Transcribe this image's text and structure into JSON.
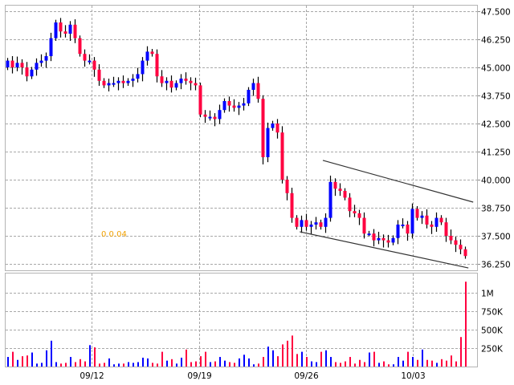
{
  "chart_data": {
    "type": "candlestick",
    "price_axis": {
      "ticks": [
        "47.500",
        "46.250",
        "45.000",
        "43.750",
        "42.500",
        "41.250",
        "40.000",
        "38.750",
        "37.500",
        "36.250"
      ],
      "ylim": [
        36.25,
        47.5
      ]
    },
    "volume_axis": {
      "ticks": [
        "1M",
        "750K",
        "500K",
        "250K"
      ],
      "ylim_k": [
        0,
        1000
      ]
    },
    "date_labels": [
      {
        "label": "09/12",
        "bar": 17.5
      },
      {
        "label": "09/19",
        "bar": 39.8
      },
      {
        "label": "09/26",
        "bar": 62
      },
      {
        "label": "10/03",
        "bar": 84.2
      }
    ],
    "indicator_text": "0 0.04",
    "up_color": "#0000ff",
    "down_color": "#ff0040",
    "first_open": 45.0,
    "close": [
      45.3,
      45.0,
      45.2,
      45.0,
      44.6,
      44.9,
      45.2,
      45.3,
      45.5,
      46.3,
      47.0,
      46.6,
      46.5,
      46.9,
      46.3,
      45.6,
      45.3,
      45.3,
      44.9,
      44.4,
      44.2,
      44.3,
      44.3,
      44.4,
      44.3,
      44.4,
      44.5,
      44.7,
      45.3,
      45.7,
      45.6,
      44.6,
      44.3,
      44.4,
      44.1,
      44.3,
      44.5,
      44.4,
      44.3,
      44.2,
      42.9,
      42.8,
      42.8,
      42.7,
      43.1,
      43.5,
      43.3,
      43.2,
      43.3,
      43.4,
      44.0,
      44.3,
      43.6,
      41.0,
      42.3,
      42.5,
      42.1,
      40.0,
      39.4,
      38.3,
      37.9,
      38.2,
      37.9,
      38.0,
      38.1,
      37.9,
      38.3,
      39.9,
      39.6,
      39.5,
      39.2,
      38.6,
      38.5,
      38.3,
      37.6,
      37.6,
      37.3,
      37.4,
      37.3,
      37.2,
      37.4,
      38.0,
      38.0,
      37.6,
      38.7,
      38.3,
      38.4,
      38.0,
      37.9,
      38.3,
      38.1,
      37.5,
      37.3,
      37.1,
      36.9,
      36.6
    ],
    "volume_k": [
      130,
      200,
      90,
      140,
      150,
      190,
      40,
      50,
      220,
      350,
      60,
      40,
      50,
      130,
      60,
      100,
      70,
      290,
      260,
      40,
      50,
      110,
      30,
      40,
      40,
      60,
      50,
      60,
      120,
      110,
      50,
      40,
      200,
      80,
      100,
      40,
      120,
      230,
      60,
      70,
      140,
      200,
      60,
      70,
      130,
      80,
      60,
      50,
      110,
      160,
      110,
      30,
      40,
      130,
      270,
      220,
      140,
      300,
      350,
      420,
      170,
      200,
      130,
      70,
      60,
      200,
      220,
      130,
      60,
      50,
      70,
      130,
      40,
      90,
      60,
      190,
      200,
      50,
      70,
      30,
      30,
      130,
      80,
      200,
      130,
      90,
      230,
      90,
      80,
      50,
      100,
      80,
      150,
      70,
      400,
      1150
    ],
    "trendlines": [
      {
        "name": "upper",
        "from": [
          65.5,
          40.86
        ],
        "to": [
          96.7,
          39.0
        ]
      },
      {
        "name": "lower",
        "from": [
          60.7,
          37.68
        ],
        "to": [
          95.7,
          36.07
        ]
      }
    ]
  }
}
